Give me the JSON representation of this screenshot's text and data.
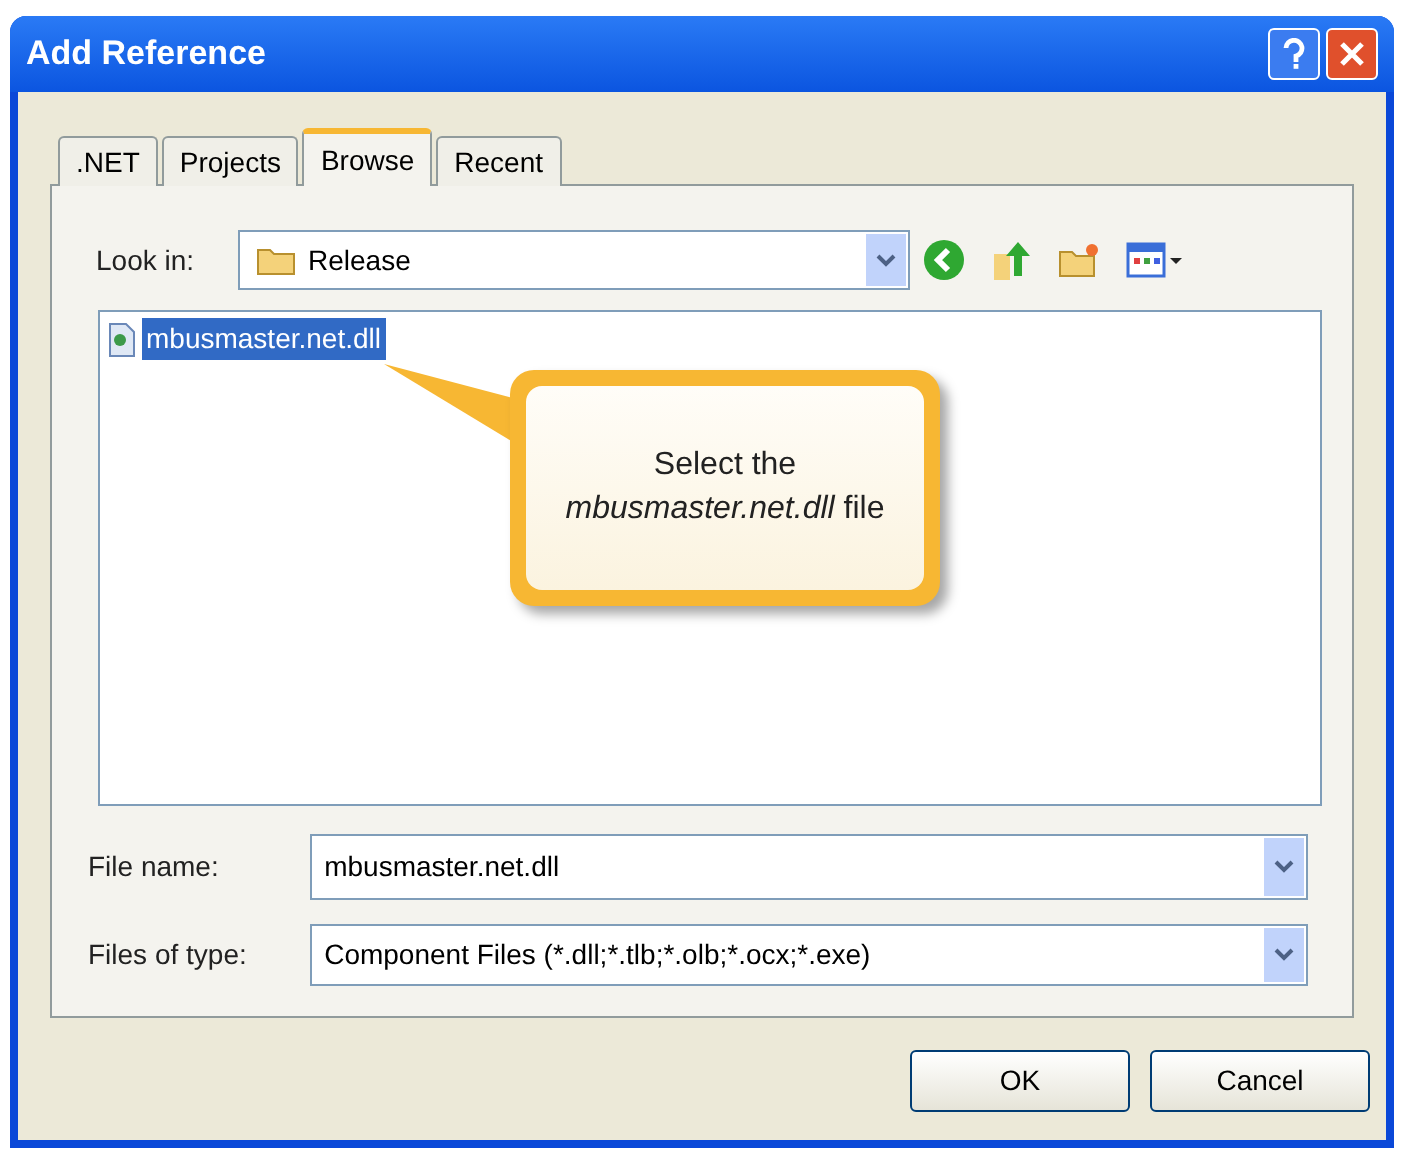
{
  "window": {
    "title": "Add Reference"
  },
  "tabs": [
    {
      "label": ".NET",
      "selected": false
    },
    {
      "label": "Projects",
      "selected": false
    },
    {
      "label": "Browse",
      "selected": true
    },
    {
      "label": "Recent",
      "selected": false
    }
  ],
  "look_in": {
    "label": "Look in:",
    "value": "Release"
  },
  "files": [
    {
      "name": "mbusmaster.net.dll",
      "selected": true
    }
  ],
  "callout": {
    "text": "Select the *mbusmaster.net.dll* file"
  },
  "file_name": {
    "label": "File name:",
    "value": "mbusmaster.net.dll"
  },
  "files_of_type": {
    "label": "Files of type:",
    "value": "Component Files (*.dll;*.tlb;*.olb;*.ocx;*.exe)"
  },
  "buttons": [
    "OK",
    "Cancel"
  ]
}
